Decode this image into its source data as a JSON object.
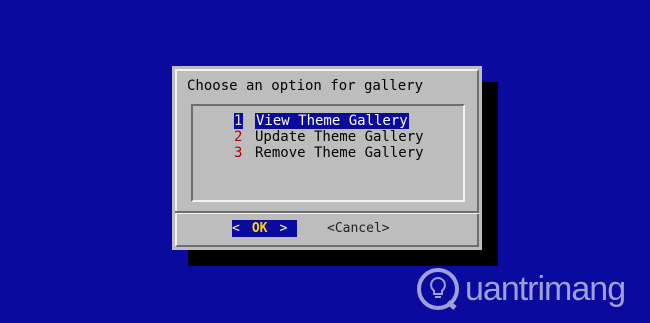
{
  "dialog": {
    "title": "Choose an option for gallery",
    "items": [
      {
        "tag": "1",
        "label": "View Theme Gallery",
        "selected": true
      },
      {
        "tag": "2",
        "label": "Update Theme Gallery",
        "selected": false
      },
      {
        "tag": "3",
        "label": "Remove Theme Gallery",
        "selected": false
      }
    ],
    "buttons": {
      "ok_left": "<",
      "ok_label": "OK",
      "ok_right": ">",
      "cancel_label": "<Cancel>"
    }
  },
  "watermark": {
    "text": "uantrimang",
    "icon": "lightbulb-icon"
  },
  "colors": {
    "background": "#0a0a9e",
    "dialog": "#bdbdbd",
    "highlight": "#0a0a9e",
    "tag": "#b00000",
    "ok_text": "#ffd400"
  }
}
